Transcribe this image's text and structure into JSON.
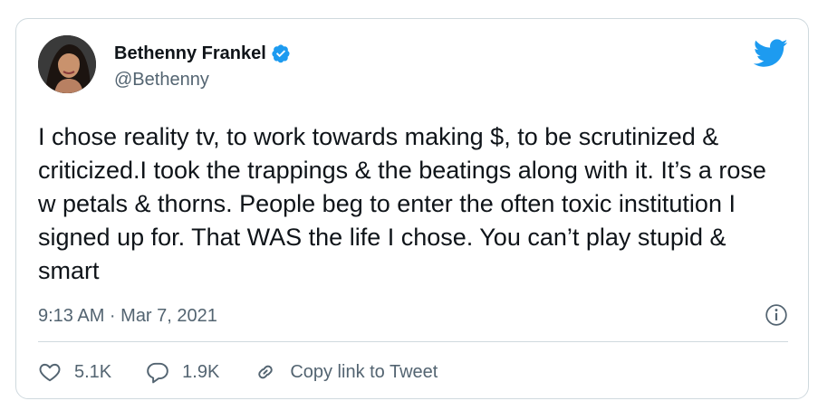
{
  "tweet": {
    "author": {
      "name": "Bethenny Frankel",
      "handle": "@Bethenny",
      "verified": true
    },
    "text": "I chose reality tv, to work towards making $, to be scrutinized & criticized.I took the trappings & the beatings along with it. It’s a rose w petals & thorns. People beg to enter the often toxic institution I signed up for. That WAS the life I chose. You can’t play stupid & smart",
    "timestamp": "9:13 AM · Mar 7, 2021",
    "actions": {
      "likes": "5.1K",
      "replies": "1.9K",
      "copy_link": "Copy link to Tweet"
    }
  },
  "icons": {
    "brand": "twitter-bird-icon",
    "verified": "verified-badge-icon",
    "info": "info-icon",
    "like": "heart-icon",
    "reply": "reply-bubble-icon",
    "copy": "link-icon"
  },
  "colors": {
    "brand_blue": "#1d9bf0",
    "text_primary": "#0f1419",
    "text_secondary": "#536471",
    "border": "#cfd9de"
  }
}
